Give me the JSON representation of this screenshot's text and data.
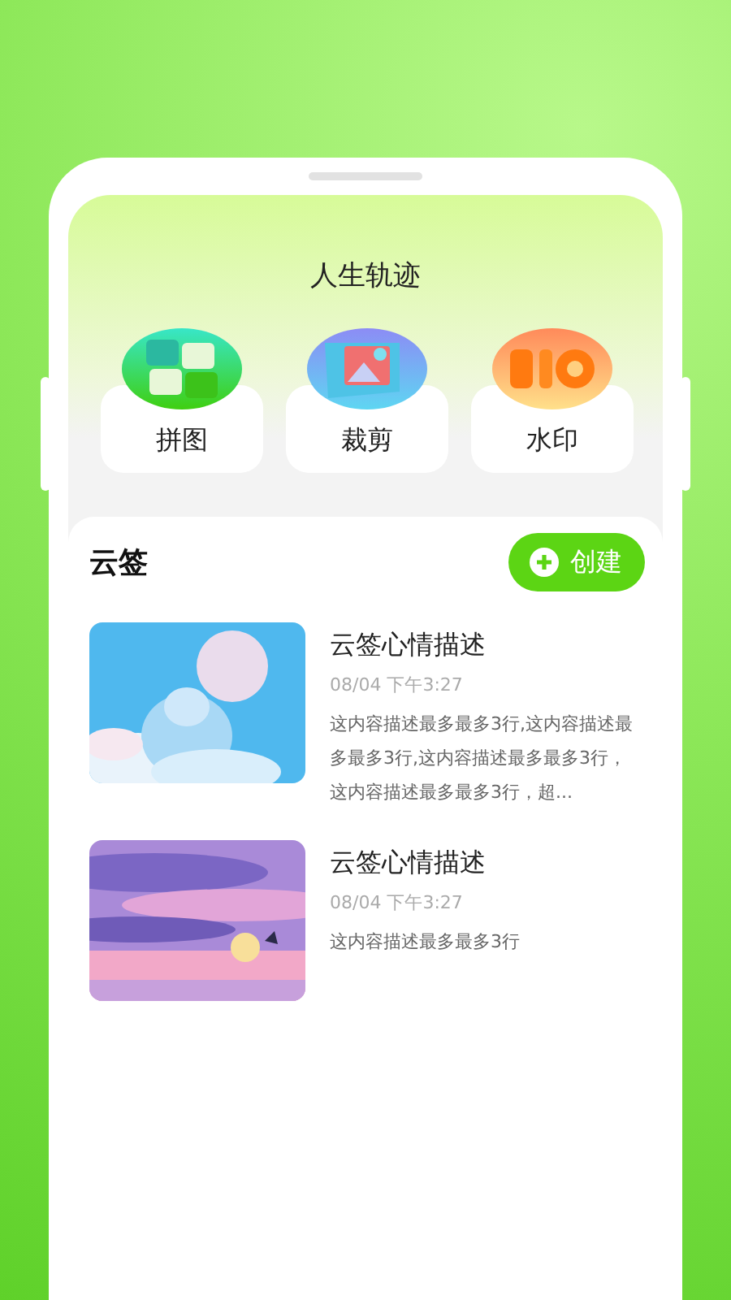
{
  "header": {
    "title": "人生轨迹"
  },
  "tools": [
    {
      "label": "拼图",
      "kind": "puzzle"
    },
    {
      "label": "裁剪",
      "kind": "crop"
    },
    {
      "label": "水印",
      "kind": "watermark"
    }
  ],
  "notes": {
    "title": "云签",
    "create_button": "创建",
    "items": [
      {
        "title": "云签心情描述",
        "time": "08/04 下午3:27",
        "description": "这内容描述最多最多3行,这内容描述最多最多3行,这内容描述最多最多3行，这内容描述最多最多3行，超..."
      },
      {
        "title": "云签心情描述",
        "time": "08/04 下午3:27",
        "description": "这内容描述最多最多3行"
      }
    ]
  }
}
